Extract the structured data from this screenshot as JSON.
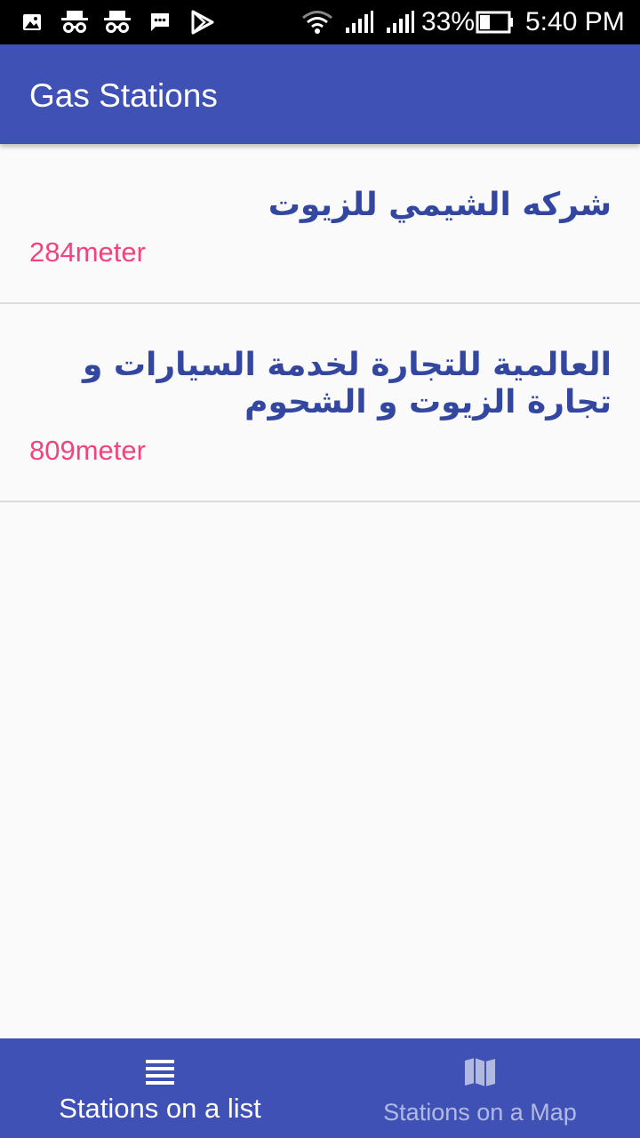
{
  "status_bar": {
    "battery_percent": "33%",
    "time": "5:40 PM",
    "icons": [
      "image-notification-icon",
      "incognito-icon",
      "incognito-icon",
      "message-icon",
      "play-store-icon",
      "wifi-icon",
      "signal-icon",
      "signal-icon",
      "battery-icon"
    ]
  },
  "app_bar": {
    "title": "Gas Stations",
    "color": "#3f51b5"
  },
  "stations": [
    {
      "name": "شركه الشيمي للزيوت",
      "distance": "284meter"
    },
    {
      "name": "العالمية للتجارة لخدمة السيارات و تجارة الزيوت و الشحوم",
      "distance": "809meter"
    }
  ],
  "bottom_nav": {
    "items": [
      {
        "label": "Stations on a list",
        "icon": "list-icon",
        "active": true
      },
      {
        "label": "Stations on a Map",
        "icon": "map-icon",
        "active": false
      }
    ]
  },
  "colors": {
    "primary": "#3f51b5",
    "station_name": "#3347a0",
    "distance": "#f0457c"
  }
}
